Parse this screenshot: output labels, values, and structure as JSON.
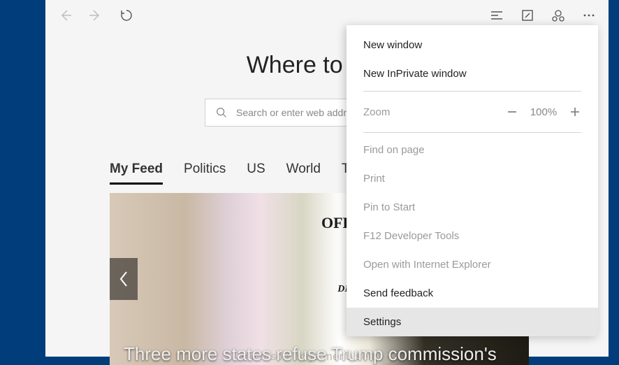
{
  "heading": "Where to next?",
  "search": {
    "placeholder": "Search or enter web address"
  },
  "feed": {
    "tabs": [
      "My Feed",
      "Politics",
      "US",
      "World",
      "Technology"
    ],
    "active_index": 0
  },
  "hero": {
    "partial_sign_top": "OFFICI",
    "partial_sign_bottom": "DID YOU",
    "headline_partial": "Three more states refuse Trump commission's",
    "watermark": "microsoft edge menu settings"
  },
  "menu": {
    "new_window": "New window",
    "new_inprivate": "New InPrivate window",
    "zoom_label": "Zoom",
    "zoom_value": "100%",
    "find": "Find on page",
    "print": "Print",
    "pin": "Pin to Start",
    "devtools": "F12 Developer Tools",
    "open_ie": "Open with Internet Explorer",
    "feedback": "Send feedback",
    "settings": "Settings"
  }
}
